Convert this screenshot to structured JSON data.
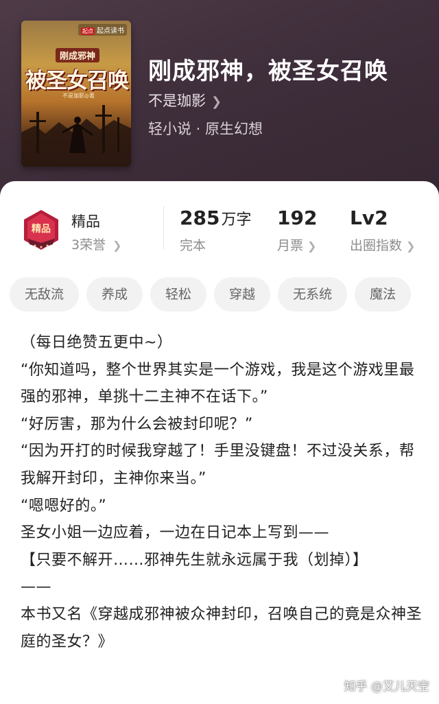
{
  "book": {
    "title": "刚成邪神，被圣女召唤",
    "author": "不是珈影",
    "genre": "轻小说 · 原生幻想"
  },
  "cover": {
    "publisher_mark": "起点",
    "publisher": "起点读书",
    "small_title": "刚成邪神",
    "big_title": "被圣女召唤",
    "author_line": "不是珈影◎著"
  },
  "honor": {
    "badge_icon": "premium-badge",
    "badge_text": "精品",
    "title": "精品",
    "subtitle": "3荣誉"
  },
  "stats": [
    {
      "value": "285",
      "unit": "万字",
      "label": "完本"
    },
    {
      "value": "192",
      "unit": "",
      "label": "月票"
    },
    {
      "value": "Lv2",
      "unit": "",
      "label": "出圈指数"
    }
  ],
  "tags": [
    "无敌流",
    "养成",
    "轻松",
    "穿越",
    "无系统",
    "魔法"
  ],
  "description": [
    "（每日绝赞五更中~）",
    "“你知道吗，整个世界其实是一个游戏，我是这个游戏里最强的邪神，单挑十二主神不在话下。”",
    "“好厉害，那为什么会被封印呢？”",
    "“因为开打的时候我穿越了！手里没键盘！不过没关系，帮我解开封印，主神你来当。”",
    "“嗯嗯好的。”",
    "圣女小姐一边应着，一边在日记本上写到——",
    "【只要不解开……邪神先生就永远属于我（划掉）】",
    "——",
    "本书又名《穿越成邪神被众神封印，召唤自己的竟是众神圣庭的圣女？》"
  ],
  "watermark": "知乎 @艾儿天空",
  "colors": {
    "hero_bg": "#3f2e3b",
    "text_primary": "#222222",
    "text_secondary": "#8c8c8c",
    "tag_bg": "#f2f2f2"
  }
}
